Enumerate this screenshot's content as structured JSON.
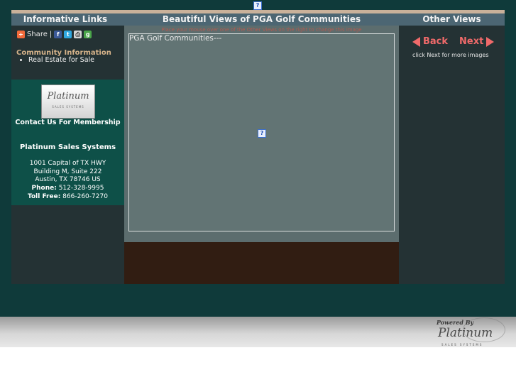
{
  "colors": {
    "page_bg": "#0f3a3a",
    "column_bg": "#243234",
    "contact_bg": "#0e5048",
    "header_bar": "#4c6673",
    "accent": "#f06a6a",
    "heading_tan": "#d6b38a"
  },
  "header": {
    "left_title": "Informative Links",
    "center_title": "Beautiful Views of PGA Golf Communities",
    "right_title": "Other Views"
  },
  "top_image": {
    "icon": "broken-image-icon",
    "glyph": "?"
  },
  "left": {
    "share_label": "Share",
    "share_separator": "|",
    "share_icons": [
      "share-plus-icon",
      "facebook-icon",
      "twitter-icon",
      "print-icon",
      "google-icon"
    ],
    "community_title": "Community Information",
    "community_items": [
      "Real Estate for Sale"
    ],
    "logo_script": "Platinum",
    "logo_sub": "SALES SYSTEMS",
    "contact_membership": "Contact Us For Membership",
    "company_name": "Platinum Sales Systems",
    "address_line1": "1001 Capital of TX HWY",
    "address_line2": "Building M, Suite 222",
    "address_line3": "Austin, TX 78746 US",
    "phone_label": "Phone:",
    "phone": "512-328-9995",
    "tollfree_label": "Toll Free:",
    "tollfree": "866-260-7270"
  },
  "center": {
    "hint": "Place your mouse over one of the Other Views on the right to change this image",
    "viewer_title": "PGA Golf Communities---",
    "viewer_image_glyph": "?"
  },
  "right": {
    "back_label": "Back",
    "next_label": "Next",
    "click_next": "click Next for more images"
  },
  "footer": {
    "powered_by": "Powered By",
    "logo_script": "Platinum",
    "logo_sub": "SALES SYSTEMS"
  }
}
